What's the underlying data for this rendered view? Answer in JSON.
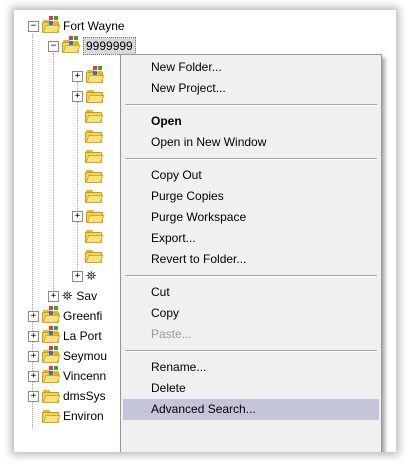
{
  "tree": {
    "root": {
      "label": "Fort Wayne",
      "expander": "−"
    },
    "child": {
      "label": "9999999",
      "expander": "−"
    },
    "partial_sav": "Sav",
    "siblings": [
      {
        "label": "Greenfi",
        "expander": "+"
      },
      {
        "label": "La Port",
        "expander": "+"
      },
      {
        "label": "Seymou",
        "expander": "+"
      },
      {
        "label": "Vincenn",
        "expander": "+"
      },
      {
        "label": "dmsSys",
        "expander": "+"
      },
      {
        "label": "Environ",
        "expander": ""
      }
    ]
  },
  "context_menu": {
    "items": [
      {
        "label": "New Folder...",
        "style": "normal"
      },
      {
        "label": "New Project...",
        "style": "normal"
      },
      {
        "separator": true
      },
      {
        "label": "Open",
        "style": "bold"
      },
      {
        "label": "Open in New Window",
        "style": "normal"
      },
      {
        "separator": true
      },
      {
        "label": "Copy Out",
        "style": "normal"
      },
      {
        "label": "Purge Copies",
        "style": "normal"
      },
      {
        "label": "Purge Workspace",
        "style": "normal"
      },
      {
        "label": "Export...",
        "style": "normal"
      },
      {
        "label": "Revert to Folder...",
        "style": "normal"
      },
      {
        "separator": true
      },
      {
        "label": "Cut",
        "style": "normal"
      },
      {
        "label": "Copy",
        "style": "normal"
      },
      {
        "label": "Paste...",
        "style": "disabled"
      },
      {
        "separator": true
      },
      {
        "label": "Rename...",
        "style": "normal"
      },
      {
        "label": "Delete",
        "style": "normal"
      },
      {
        "label": "Advanced Search...",
        "style": "highlighted"
      }
    ]
  },
  "colors": {
    "highlight": "#c5c5d9",
    "menu_background": "#f0f0f0",
    "folder_yellow": "#f4d35c"
  }
}
